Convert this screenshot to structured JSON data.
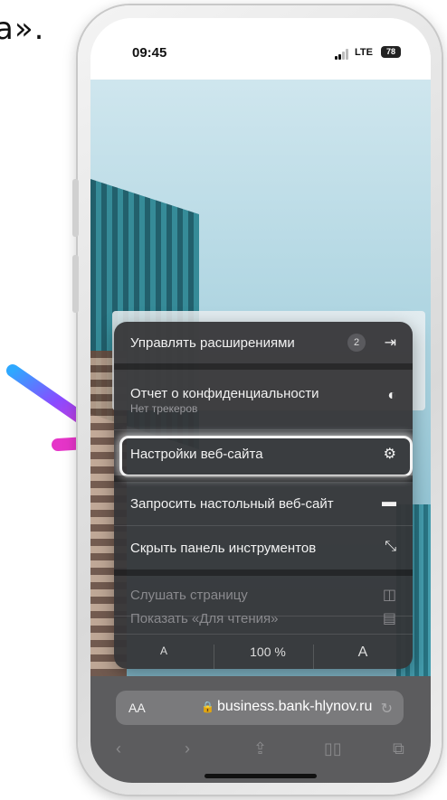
{
  "caption": "а».",
  "status_bar": {
    "time": "09:45",
    "network": "LTE",
    "battery": "78"
  },
  "menu": {
    "items": [
      {
        "label": "Управлять расширениями",
        "badge": "2",
        "icon": "extensions-icon"
      },
      {
        "label": "Отчет о конфиденциальности",
        "sublabel": "Нет трекеров",
        "icon": "shield-icon"
      },
      {
        "label": "Настройки веб-сайта",
        "icon": "gear-icon",
        "highlighted": true
      },
      {
        "label": "Запросить настольный веб-сайт",
        "icon": "desktop-icon"
      },
      {
        "label": "Скрыть панель инструментов",
        "icon": "resize-icon"
      },
      {
        "label": "Слушать страницу",
        "icon": "speaker-icon",
        "disabled": true
      },
      {
        "label": "Показать «Для чтения»",
        "icon": "reader-icon",
        "disabled": true
      }
    ],
    "zoom": {
      "decrease": "A",
      "level": "100 %",
      "increase": "A"
    }
  },
  "address_bar": {
    "aa": "AA",
    "url": "business.bank-hlynov.ru"
  },
  "colors": {
    "menu_bg": "#343436",
    "arrow_start": "#2f6bff",
    "arrow_end": "#e535c8"
  }
}
